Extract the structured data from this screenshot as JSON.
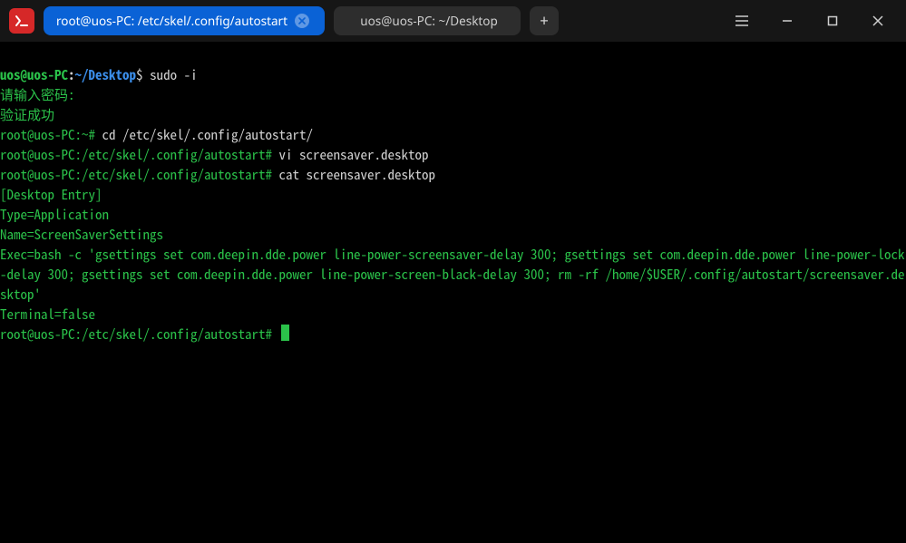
{
  "titlebar": {
    "app_icon": "terminal-icon",
    "tabs": [
      {
        "label": "root@uos-PC: /etc/skel/.config/autostart",
        "active": true,
        "closeable": true
      },
      {
        "label": "uos@uos-PC: ~/Desktop",
        "active": false,
        "closeable": false
      }
    ],
    "new_tab": "+",
    "controls": {
      "menu": "menu",
      "minimize": "minimize",
      "maximize": "maximize",
      "close": "close"
    }
  },
  "colors": {
    "tab_active_bg": "#0a62d6",
    "tab_inactive_bg": "#2d2d2d",
    "app_icon_bg": "#d62828",
    "term_green": "#2bc24a",
    "term_blue": "#3b8eea"
  },
  "prompt1": {
    "user": "uos@uos-PC",
    "sep": ":",
    "path": "~/Desktop",
    "sym": "$",
    "cmd": "sudo -i"
  },
  "msg_pw": "请输入密码:",
  "msg_ok": "验证成功",
  "root_prompts": [
    {
      "prefix": "root@uos-PC:~#",
      "cmd": "cd /etc/skel/.config/autostart/"
    },
    {
      "prefix": "root@uos-PC:/etc/skel/.config/autostart#",
      "cmd": "vi screensaver.desktop"
    },
    {
      "prefix": "root@uos-PC:/etc/skel/.config/autostart#",
      "cmd": "cat screensaver.desktop"
    }
  ],
  "file_lines": [
    "[Desktop Entry]",
    "Type=Application",
    "Name=ScreenSaverSettings",
    "Exec=bash -c 'gsettings set com.deepin.dde.power line-power-screensaver-delay 300; gsettings set com.deepin.dde.power line-power-lock-delay 300; gsettings set com.deepin.dde.power line-power-screen-black-delay 300; rm -rf /home/$USER/.config/autostart/screensaver.desktop'",
    "Terminal=false"
  ],
  "final_prompt": {
    "prefix": "root@uos-PC:/etc/skel/.config/autostart#",
    "cmd": ""
  }
}
